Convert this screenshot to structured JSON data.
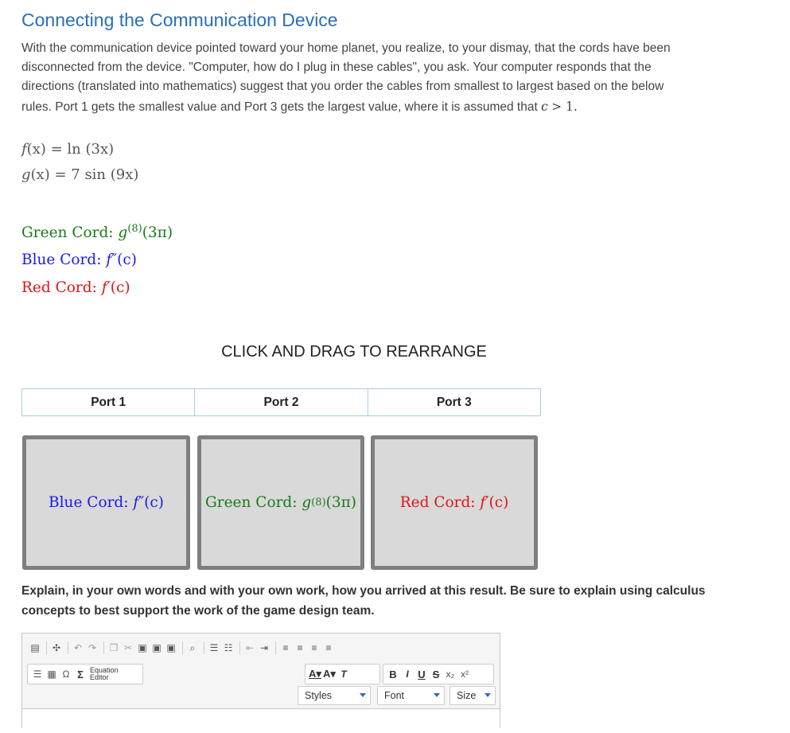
{
  "title": "Connecting the Communication Device",
  "intro": {
    "text": "With the communication device pointed toward your home planet, you realize, to your dismay, that the cords have been disconnected from the device. \"Computer, how do I plug in these cables\", you ask. Your computer responds that the directions (translated into mathematics) suggest that you order the cables from smallest to largest based on the below rules. Port 1 gets the smallest value and Port 3 gets the largest value, where it is assumed that",
    "condition_var": "c",
    "condition_rest": "> 1."
  },
  "functions": {
    "f": {
      "name": "f",
      "arg": "(x)",
      "eq": " = ",
      "body": "ln (3x)"
    },
    "g": {
      "name": "g",
      "arg": "(x)",
      "eq": " = ",
      "body": "7 sin (9x)"
    }
  },
  "cords": {
    "green": {
      "label": "Green Cord:",
      "expr": "g",
      "sup": "(8)",
      "arg": "(3π)"
    },
    "blue": {
      "label": "Blue Cord:",
      "expr": "f″",
      "arg": "(c)"
    },
    "red": {
      "label": "Red Cord:",
      "expr": "f′",
      "arg": "(c)"
    }
  },
  "drag_title": "CLICK AND DRAG TO REARRANGE",
  "ports": [
    "Port 1",
    "Port 2",
    "Port 3"
  ],
  "slots": [
    {
      "label": "Blue Cord:",
      "expr": "f″",
      "sup": "",
      "arg": "(c)"
    },
    {
      "label": "Green Cord:",
      "expr": "g",
      "sup": "(8)",
      "arg": "(3π)"
    },
    {
      "label": "Red Cord:",
      "expr": "f′",
      "sup": "",
      "arg": "(c)"
    }
  ],
  "explain": "Explain, in your own words and with your own work, how you arrived at this result. Be sure to explain using calculus concepts to best support the work of the game design team.",
  "editor": {
    "equation_editor": [
      "Equation",
      "Editor"
    ],
    "styles": "Styles",
    "font": "Font",
    "size": "Size",
    "format": {
      "bold": "B",
      "italic": "I",
      "underline": "U",
      "strike": "S",
      "sub": "x₂",
      "sup": "x²"
    },
    "icons": [
      "source-icon",
      "maximize-icon",
      "undo-icon",
      "redo-icon",
      "copy-icon",
      "cut-icon",
      "paste-icon",
      "paste-text-icon",
      "paste-word-icon",
      "find-icon",
      "numbered-list-icon",
      "bulleted-list-icon",
      "outdent-icon",
      "indent-icon",
      "align-left-icon",
      "align-center-icon",
      "align-right-icon",
      "justify-icon"
    ]
  },
  "colors": {
    "title": "#2a6ebb",
    "green": "#1a7a1a",
    "blue": "#1a1aee",
    "red": "#e01515",
    "slot_bg": "#d9d9d9",
    "slot_border": "#7f7f7f"
  }
}
